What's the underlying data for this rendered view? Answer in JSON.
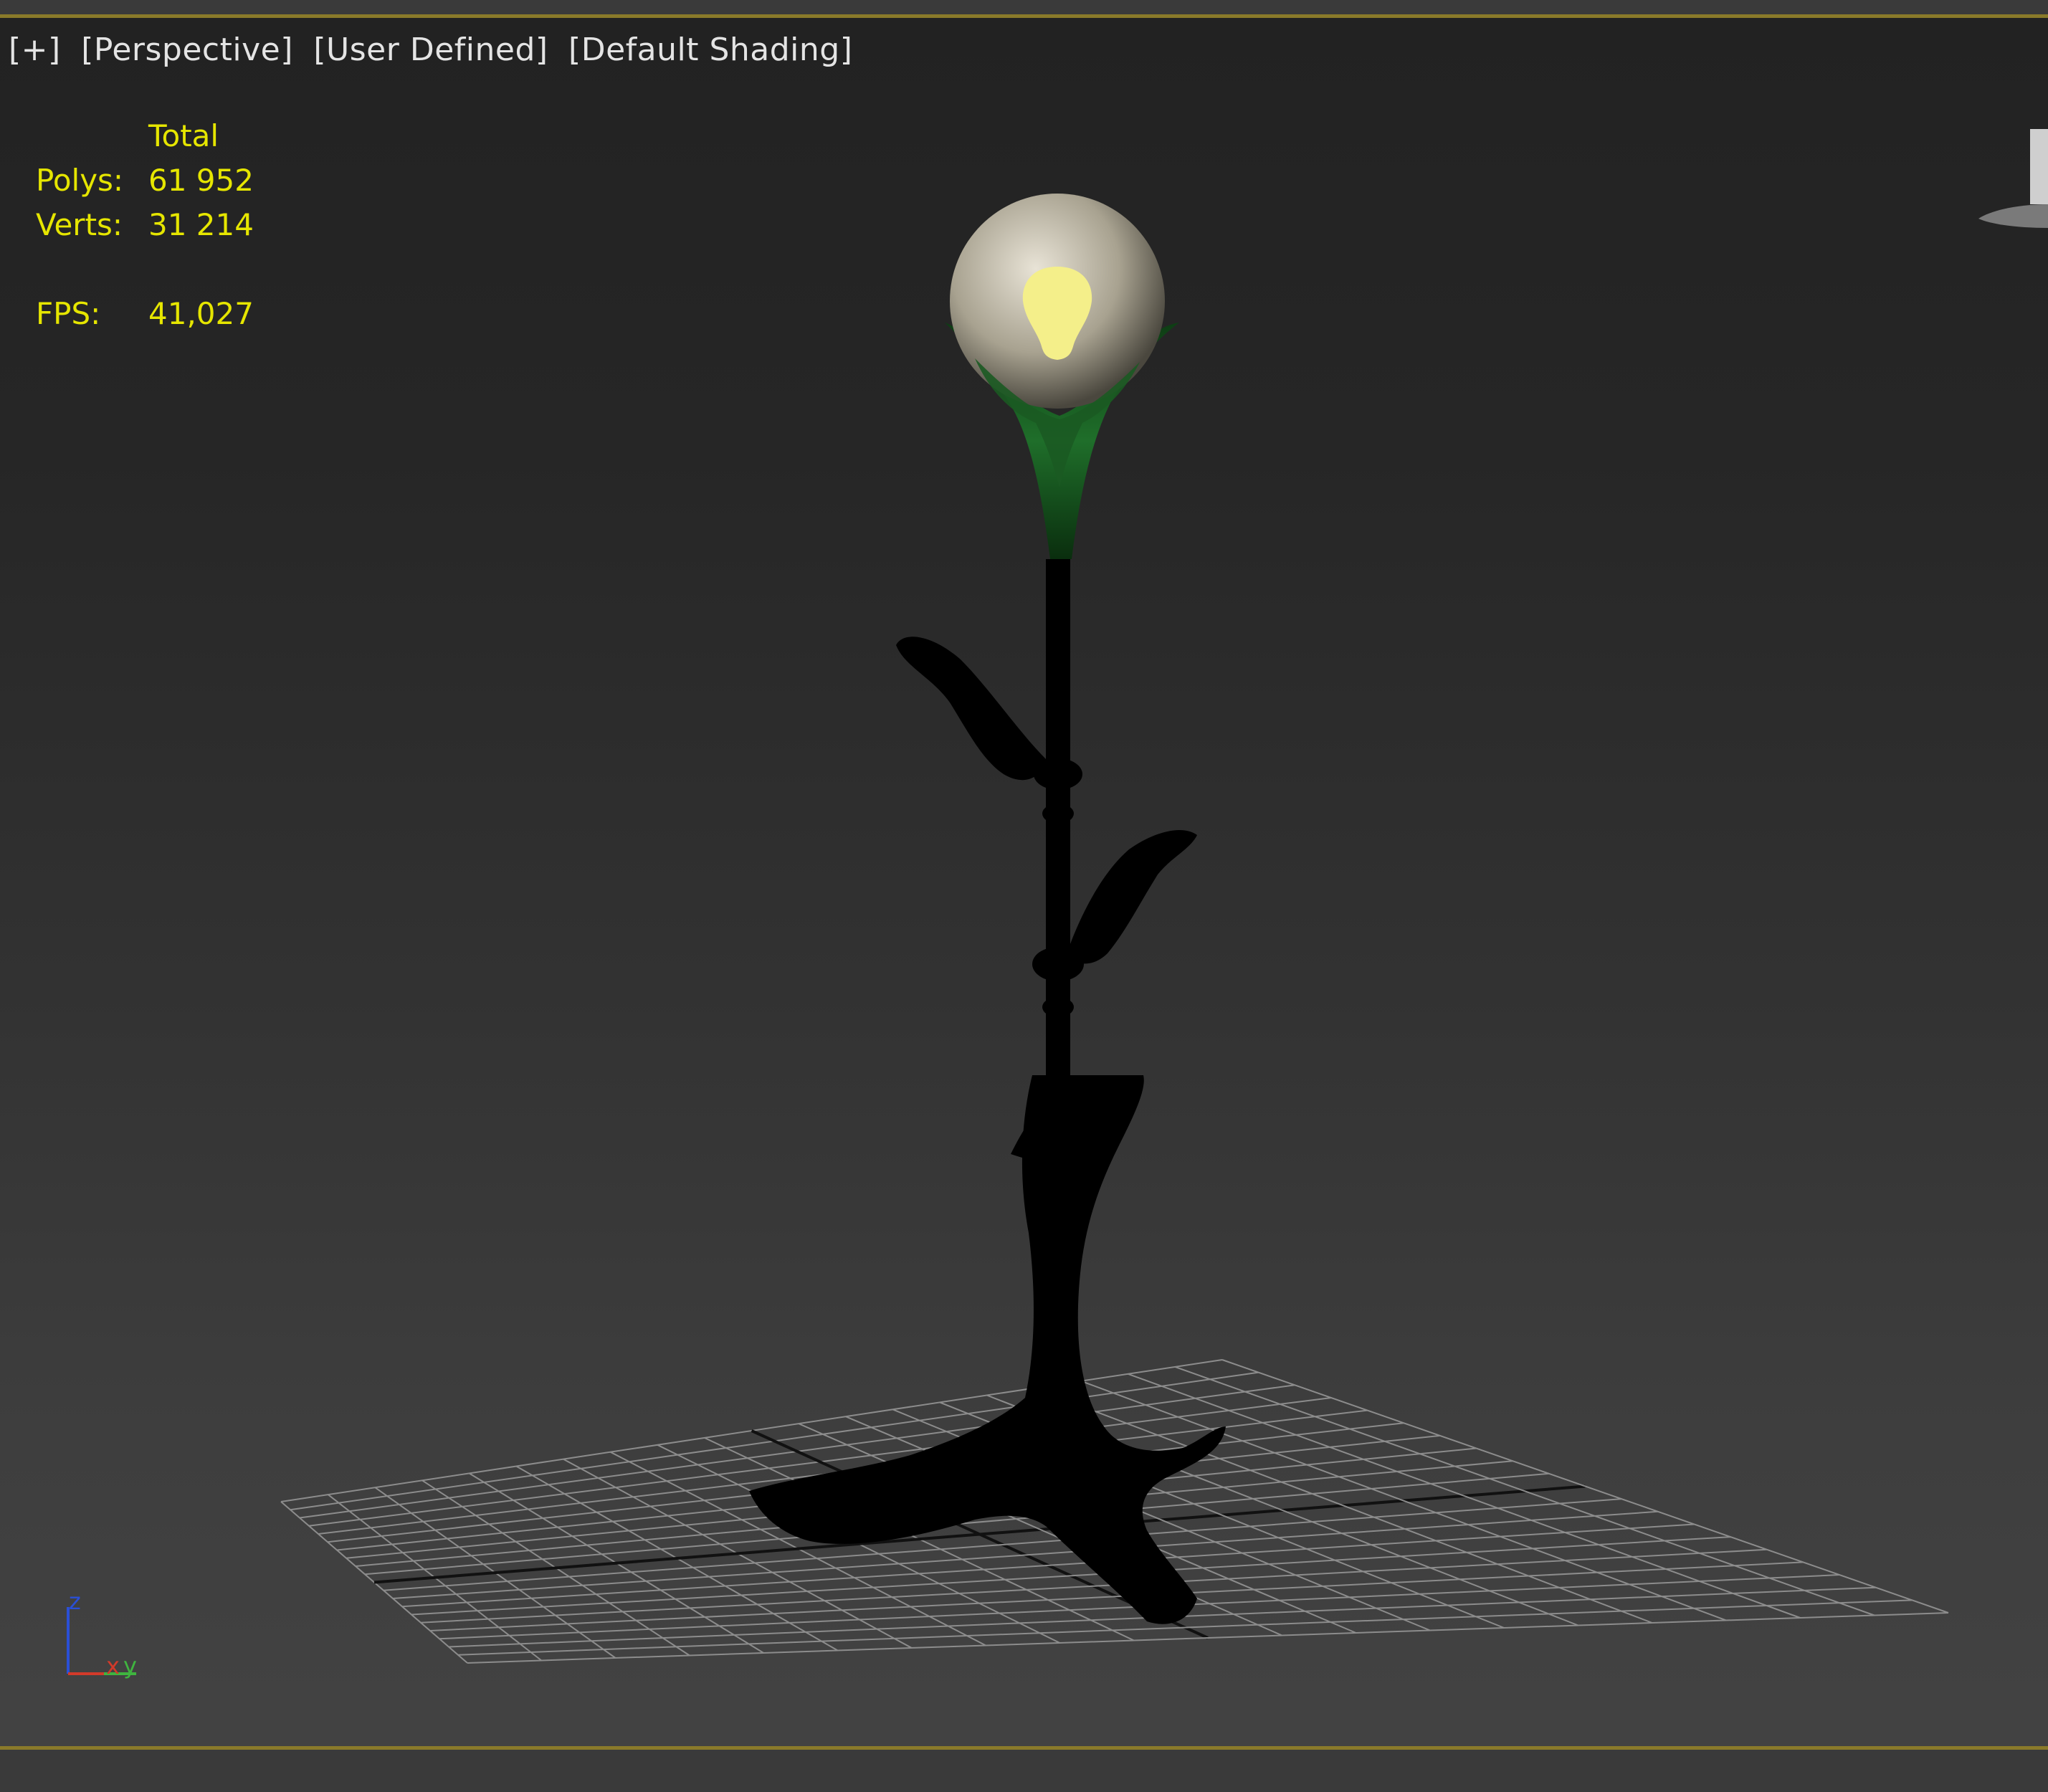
{
  "viewport": {
    "labels": [
      "[+]",
      "[Perspective]",
      "[User Defined]",
      "[Default Shading]"
    ]
  },
  "stats": {
    "header": "Total",
    "polys_label": "Polys:",
    "polys_value": "61 952",
    "verts_label": "Verts:",
    "verts_value": "31 214",
    "fps_label": "FPS:",
    "fps_value": "41,027"
  },
  "axis_tripod": {
    "z": "z",
    "x": "x",
    "y": "y"
  },
  "colors": {
    "stats_text": "#e6e600",
    "label_text": "#e4e4e4",
    "grid_line": "#8c8c8c",
    "grid_axis": "#111111",
    "axis_z": "#2a4fd6",
    "axis_x": "#d23a2a",
    "axis_y": "#3fb43f",
    "bulb_glow": "#f4ef8a",
    "leaf_green": "#1f6e2a",
    "silhouette": "#000000"
  }
}
